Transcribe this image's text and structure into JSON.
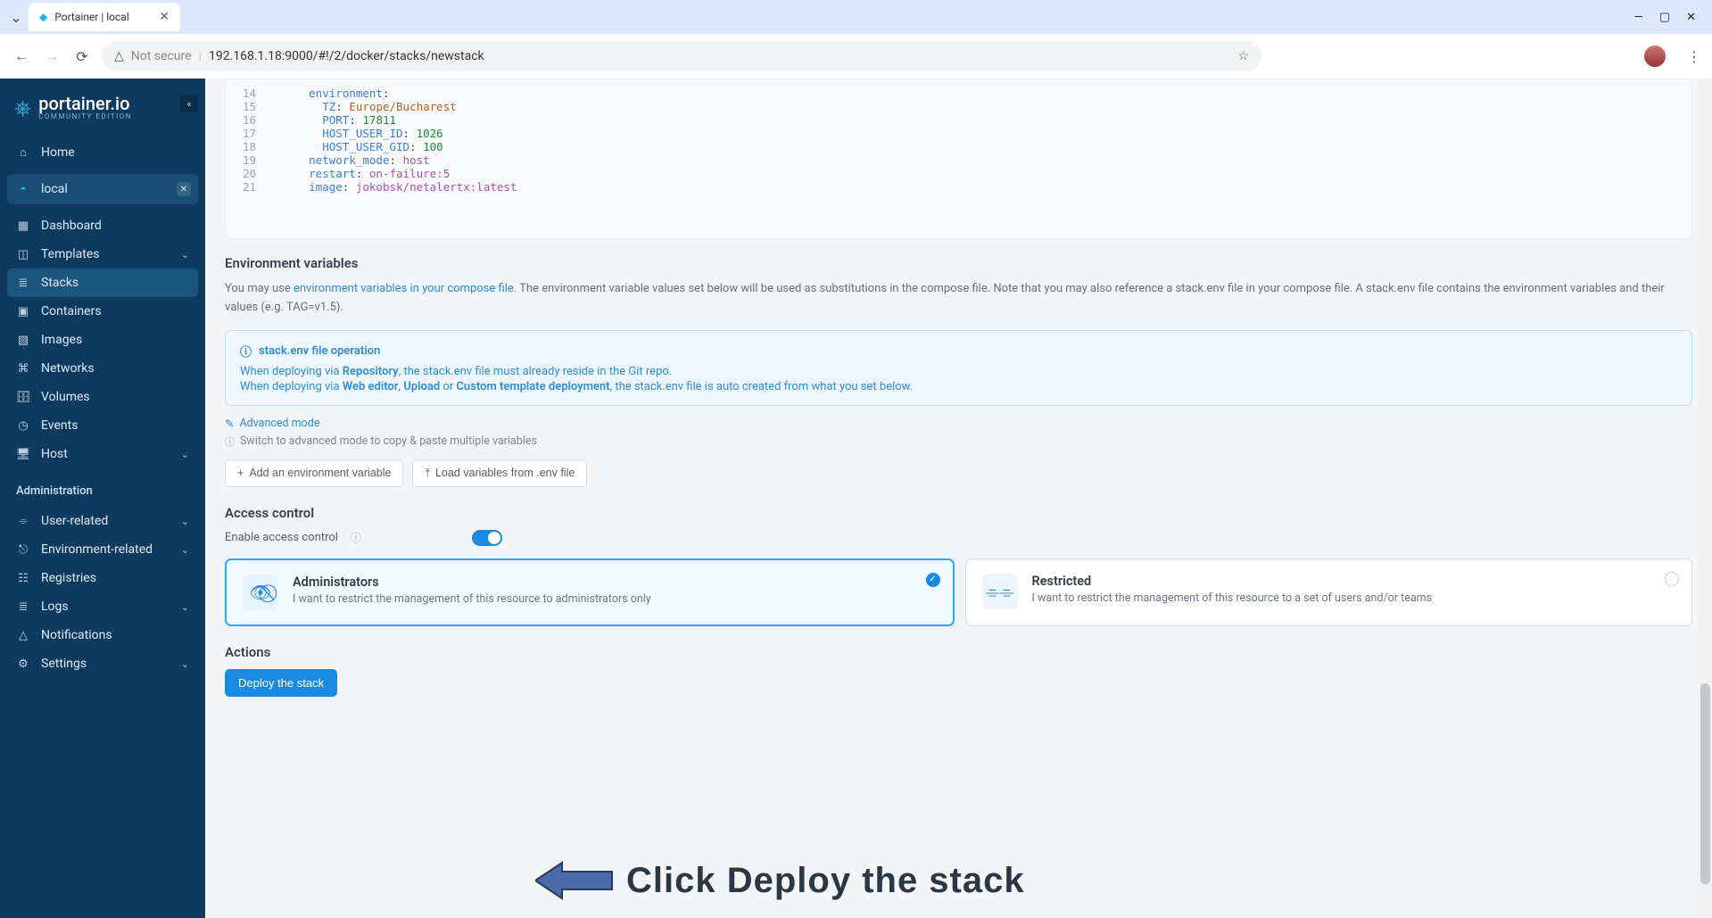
{
  "browser": {
    "tab_title": "Portainer | local",
    "url_label": "Not secure",
    "url": "192.168.1.18:9000/#!/2/docker/stacks/newstack"
  },
  "sidebar": {
    "brand": "portainer.io",
    "brand_sub": "COMMUNITY EDITION",
    "home": "Home",
    "env": "local",
    "items": [
      {
        "label": "Dashboard"
      },
      {
        "label": "Templates",
        "chev": true
      },
      {
        "label": "Stacks",
        "active": true
      },
      {
        "label": "Containers"
      },
      {
        "label": "Images"
      },
      {
        "label": "Networks"
      },
      {
        "label": "Volumes"
      },
      {
        "label": "Events"
      },
      {
        "label": "Host",
        "chev": true
      }
    ],
    "section": "Administration",
    "admin_items": [
      {
        "label": "User-related",
        "chev": true
      },
      {
        "label": "Environment-related",
        "chev": true
      },
      {
        "label": "Registries"
      },
      {
        "label": "Logs",
        "chev": true
      },
      {
        "label": "Notifications"
      },
      {
        "label": "Settings",
        "chev": true
      }
    ]
  },
  "code": [
    {
      "n": 14,
      "indent": 3,
      "key": "environment",
      "colon": ":"
    },
    {
      "n": 15,
      "indent": 4,
      "key": "TZ",
      "colon": ": ",
      "val": "Europe/Bucharest",
      "vt": "str"
    },
    {
      "n": 16,
      "indent": 4,
      "key": "PORT",
      "colon": ": ",
      "val": "17811",
      "vt": "num"
    },
    {
      "n": 17,
      "indent": 4,
      "key": "HOST_USER_ID",
      "colon": ": ",
      "val": "1026",
      "vt": "num"
    },
    {
      "n": 18,
      "indent": 4,
      "key": "HOST_USER_GID",
      "colon": ": ",
      "val": "100",
      "vt": "num"
    },
    {
      "n": 19,
      "indent": 3,
      "key": "network_mode",
      "colon": ": ",
      "val": "host",
      "vt": "id"
    },
    {
      "n": 20,
      "indent": 3,
      "key": "restart",
      "colon": ": ",
      "val": "on-failure:5",
      "vt": "id"
    },
    {
      "n": 21,
      "indent": 3,
      "key": "image",
      "colon": ": ",
      "val": "jokobsk/netalertx:latest",
      "vt": "id"
    }
  ],
  "env": {
    "title": "Environment variables",
    "help_pre": "You may use ",
    "help_link": "environment variables in your compose file",
    "help_post": ". The environment variable values set below will be used as substitutions in the compose file. Note that you may also reference a stack.env file in your compose file. A stack.env file contains the environment variables and their values (e.g. TAG=v1.5).",
    "info_title": "stack.env file operation",
    "info_l1a": "When deploying via ",
    "info_l1b": "Repository",
    "info_l1c": ", the stack.env file must already reside in the Git repo.",
    "info_l2a": "When deploying via ",
    "info_l2b": "Web editor",
    "info_l2c": ", ",
    "info_l2d": "Upload",
    "info_l2e": " or ",
    "info_l2f": "Custom template deployment",
    "info_l2g": ", the stack.env file is auto created from what you set below.",
    "adv_link": "Advanced mode",
    "adv_hint": "Switch to advanced mode to copy & paste multiple variables",
    "btn_add": "Add an environment variable",
    "btn_load": "Load variables from .env file"
  },
  "access": {
    "title": "Access control",
    "toggle_label": "Enable access control",
    "card_admin_title": "Administrators",
    "card_admin_desc": "I want to restrict the management of this resource to administrators only",
    "card_rest_title": "Restricted",
    "card_rest_desc": "I want to restrict the management of this resource to a set of users and/or teams"
  },
  "actions": {
    "title": "Actions",
    "deploy": "Deploy the stack"
  },
  "annotation": "Click Deploy the stack"
}
